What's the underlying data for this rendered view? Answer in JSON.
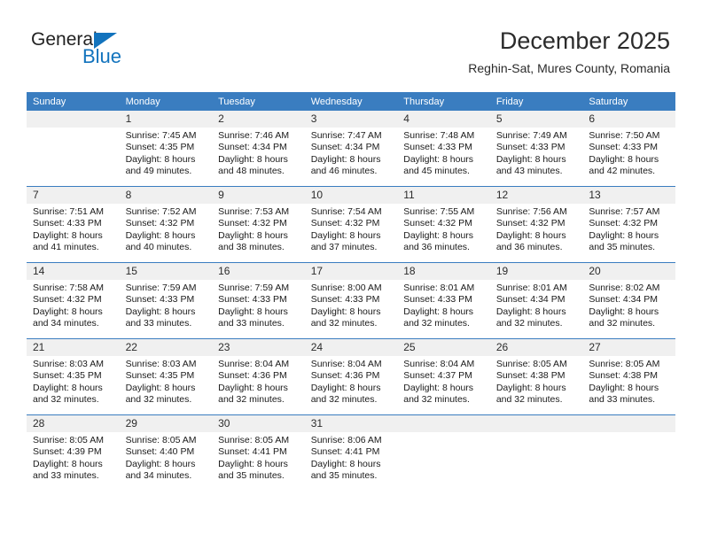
{
  "brand": {
    "name_part1": "General",
    "name_part2": "Blue",
    "accent_color": "#1273bd"
  },
  "header": {
    "title": "December 2025",
    "subtitle": "Reghin-Sat, Mures County, Romania"
  },
  "theme": {
    "header_blue": "#3a7dc0",
    "daynum_band": "#f0f0f0",
    "text": "#1a1a1a"
  },
  "weekday_headers": [
    "Sunday",
    "Monday",
    "Tuesday",
    "Wednesday",
    "Thursday",
    "Friday",
    "Saturday"
  ],
  "weeks": [
    [
      {
        "day": "",
        "empty": true,
        "sunrise": "",
        "sunset": "",
        "daylight_line1": "",
        "daylight_line2": ""
      },
      {
        "day": "1",
        "sunrise": "Sunrise: 7:45 AM",
        "sunset": "Sunset: 4:35 PM",
        "daylight_line1": "Daylight: 8 hours",
        "daylight_line2": "and 49 minutes."
      },
      {
        "day": "2",
        "sunrise": "Sunrise: 7:46 AM",
        "sunset": "Sunset: 4:34 PM",
        "daylight_line1": "Daylight: 8 hours",
        "daylight_line2": "and 48 minutes."
      },
      {
        "day": "3",
        "sunrise": "Sunrise: 7:47 AM",
        "sunset": "Sunset: 4:34 PM",
        "daylight_line1": "Daylight: 8 hours",
        "daylight_line2": "and 46 minutes."
      },
      {
        "day": "4",
        "sunrise": "Sunrise: 7:48 AM",
        "sunset": "Sunset: 4:33 PM",
        "daylight_line1": "Daylight: 8 hours",
        "daylight_line2": "and 45 minutes."
      },
      {
        "day": "5",
        "sunrise": "Sunrise: 7:49 AM",
        "sunset": "Sunset: 4:33 PM",
        "daylight_line1": "Daylight: 8 hours",
        "daylight_line2": "and 43 minutes."
      },
      {
        "day": "6",
        "sunrise": "Sunrise: 7:50 AM",
        "sunset": "Sunset: 4:33 PM",
        "daylight_line1": "Daylight: 8 hours",
        "daylight_line2": "and 42 minutes."
      }
    ],
    [
      {
        "day": "7",
        "sunrise": "Sunrise: 7:51 AM",
        "sunset": "Sunset: 4:33 PM",
        "daylight_line1": "Daylight: 8 hours",
        "daylight_line2": "and 41 minutes."
      },
      {
        "day": "8",
        "sunrise": "Sunrise: 7:52 AM",
        "sunset": "Sunset: 4:32 PM",
        "daylight_line1": "Daylight: 8 hours",
        "daylight_line2": "and 40 minutes."
      },
      {
        "day": "9",
        "sunrise": "Sunrise: 7:53 AM",
        "sunset": "Sunset: 4:32 PM",
        "daylight_line1": "Daylight: 8 hours",
        "daylight_line2": "and 38 minutes."
      },
      {
        "day": "10",
        "sunrise": "Sunrise: 7:54 AM",
        "sunset": "Sunset: 4:32 PM",
        "daylight_line1": "Daylight: 8 hours",
        "daylight_line2": "and 37 minutes."
      },
      {
        "day": "11",
        "sunrise": "Sunrise: 7:55 AM",
        "sunset": "Sunset: 4:32 PM",
        "daylight_line1": "Daylight: 8 hours",
        "daylight_line2": "and 36 minutes."
      },
      {
        "day": "12",
        "sunrise": "Sunrise: 7:56 AM",
        "sunset": "Sunset: 4:32 PM",
        "daylight_line1": "Daylight: 8 hours",
        "daylight_line2": "and 36 minutes."
      },
      {
        "day": "13",
        "sunrise": "Sunrise: 7:57 AM",
        "sunset": "Sunset: 4:32 PM",
        "daylight_line1": "Daylight: 8 hours",
        "daylight_line2": "and 35 minutes."
      }
    ],
    [
      {
        "day": "14",
        "sunrise": "Sunrise: 7:58 AM",
        "sunset": "Sunset: 4:32 PM",
        "daylight_line1": "Daylight: 8 hours",
        "daylight_line2": "and 34 minutes."
      },
      {
        "day": "15",
        "sunrise": "Sunrise: 7:59 AM",
        "sunset": "Sunset: 4:33 PM",
        "daylight_line1": "Daylight: 8 hours",
        "daylight_line2": "and 33 minutes."
      },
      {
        "day": "16",
        "sunrise": "Sunrise: 7:59 AM",
        "sunset": "Sunset: 4:33 PM",
        "daylight_line1": "Daylight: 8 hours",
        "daylight_line2": "and 33 minutes."
      },
      {
        "day": "17",
        "sunrise": "Sunrise: 8:00 AM",
        "sunset": "Sunset: 4:33 PM",
        "daylight_line1": "Daylight: 8 hours",
        "daylight_line2": "and 32 minutes."
      },
      {
        "day": "18",
        "sunrise": "Sunrise: 8:01 AM",
        "sunset": "Sunset: 4:33 PM",
        "daylight_line1": "Daylight: 8 hours",
        "daylight_line2": "and 32 minutes."
      },
      {
        "day": "19",
        "sunrise": "Sunrise: 8:01 AM",
        "sunset": "Sunset: 4:34 PM",
        "daylight_line1": "Daylight: 8 hours",
        "daylight_line2": "and 32 minutes."
      },
      {
        "day": "20",
        "sunrise": "Sunrise: 8:02 AM",
        "sunset": "Sunset: 4:34 PM",
        "daylight_line1": "Daylight: 8 hours",
        "daylight_line2": "and 32 minutes."
      }
    ],
    [
      {
        "day": "21",
        "sunrise": "Sunrise: 8:03 AM",
        "sunset": "Sunset: 4:35 PM",
        "daylight_line1": "Daylight: 8 hours",
        "daylight_line2": "and 32 minutes."
      },
      {
        "day": "22",
        "sunrise": "Sunrise: 8:03 AM",
        "sunset": "Sunset: 4:35 PM",
        "daylight_line1": "Daylight: 8 hours",
        "daylight_line2": "and 32 minutes."
      },
      {
        "day": "23",
        "sunrise": "Sunrise: 8:04 AM",
        "sunset": "Sunset: 4:36 PM",
        "daylight_line1": "Daylight: 8 hours",
        "daylight_line2": "and 32 minutes."
      },
      {
        "day": "24",
        "sunrise": "Sunrise: 8:04 AM",
        "sunset": "Sunset: 4:36 PM",
        "daylight_line1": "Daylight: 8 hours",
        "daylight_line2": "and 32 minutes."
      },
      {
        "day": "25",
        "sunrise": "Sunrise: 8:04 AM",
        "sunset": "Sunset: 4:37 PM",
        "daylight_line1": "Daylight: 8 hours",
        "daylight_line2": "and 32 minutes."
      },
      {
        "day": "26",
        "sunrise": "Sunrise: 8:05 AM",
        "sunset": "Sunset: 4:38 PM",
        "daylight_line1": "Daylight: 8 hours",
        "daylight_line2": "and 32 minutes."
      },
      {
        "day": "27",
        "sunrise": "Sunrise: 8:05 AM",
        "sunset": "Sunset: 4:38 PM",
        "daylight_line1": "Daylight: 8 hours",
        "daylight_line2": "and 33 minutes."
      }
    ],
    [
      {
        "day": "28",
        "sunrise": "Sunrise: 8:05 AM",
        "sunset": "Sunset: 4:39 PM",
        "daylight_line1": "Daylight: 8 hours",
        "daylight_line2": "and 33 minutes."
      },
      {
        "day": "29",
        "sunrise": "Sunrise: 8:05 AM",
        "sunset": "Sunset: 4:40 PM",
        "daylight_line1": "Daylight: 8 hours",
        "daylight_line2": "and 34 minutes."
      },
      {
        "day": "30",
        "sunrise": "Sunrise: 8:05 AM",
        "sunset": "Sunset: 4:41 PM",
        "daylight_line1": "Daylight: 8 hours",
        "daylight_line2": "and 35 minutes."
      },
      {
        "day": "31",
        "sunrise": "Sunrise: 8:06 AM",
        "sunset": "Sunset: 4:41 PM",
        "daylight_line1": "Daylight: 8 hours",
        "daylight_line2": "and 35 minutes."
      },
      {
        "day": "",
        "empty": true,
        "sunrise": "",
        "sunset": "",
        "daylight_line1": "",
        "daylight_line2": ""
      },
      {
        "day": "",
        "empty": true,
        "sunrise": "",
        "sunset": "",
        "daylight_line1": "",
        "daylight_line2": ""
      },
      {
        "day": "",
        "empty": true,
        "sunrise": "",
        "sunset": "",
        "daylight_line1": "",
        "daylight_line2": ""
      }
    ]
  ]
}
